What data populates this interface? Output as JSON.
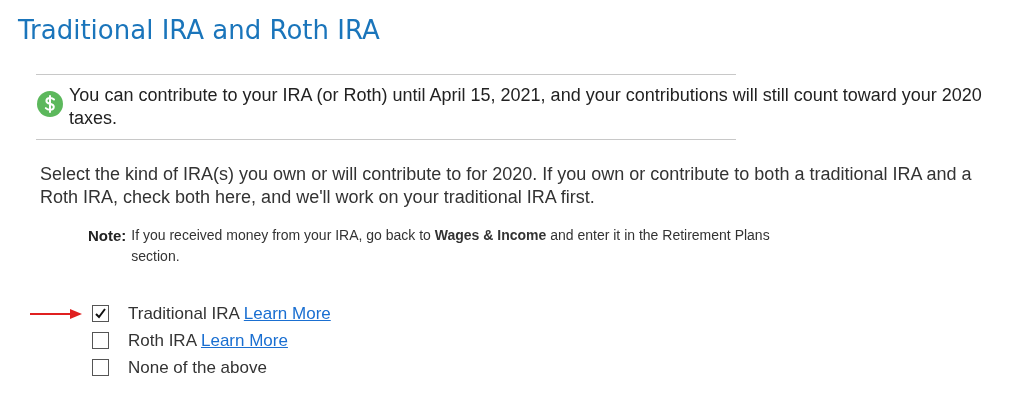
{
  "title": "Traditional IRA and Roth IRA",
  "callout": {
    "text": "You can contribute to your IRA (or Roth) until April 15, 2021, and your contributions will still count toward your 2020 taxes."
  },
  "instructions": "Select the kind of IRA(s) you own or will contribute to for 2020. If you own or contribute to both a traditional IRA and a Roth IRA, check both here, and we'll work on your traditional IRA first.",
  "note": {
    "label": "Note:",
    "text": "If you received money from your IRA, go back to **Wages & Income** and enter it in the Retirement Plans section."
  },
  "options": [
    {
      "label": "Traditional IRA",
      "link": "Learn More",
      "checked": true,
      "arrow": true
    },
    {
      "label": "Roth IRA",
      "link": "Learn More",
      "checked": false,
      "arrow": false
    },
    {
      "label": "None of the above",
      "checked": false,
      "arrow": false
    }
  ]
}
